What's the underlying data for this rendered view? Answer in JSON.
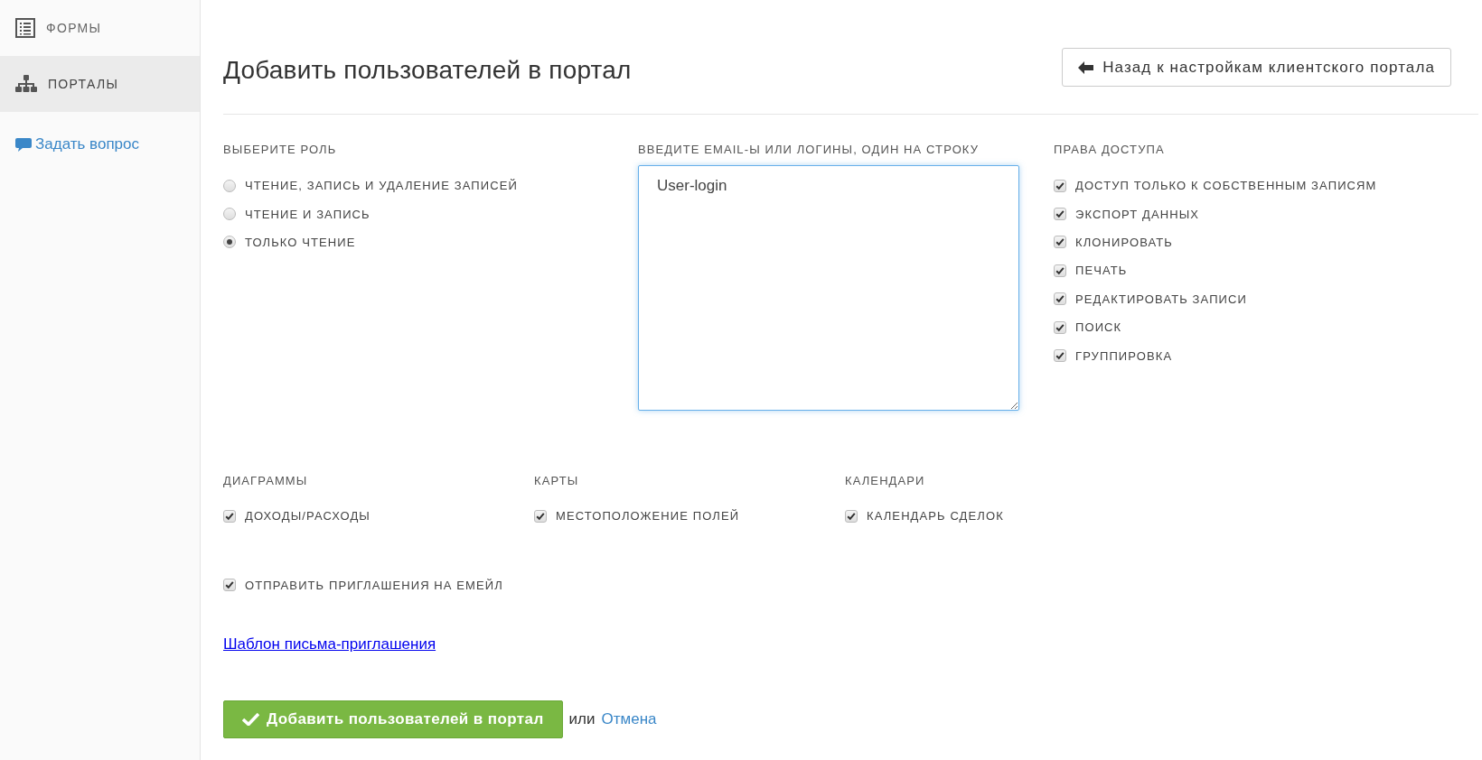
{
  "sidebar": {
    "items": [
      {
        "label": "ФОРМЫ",
        "selected": false
      },
      {
        "label": "ПОРТАЛЫ",
        "selected": true
      }
    ],
    "help_link": "Задать вопрос"
  },
  "header": {
    "title": "Добавить пользователей в портал",
    "back_button": "Назад к настройкам клиентского портала"
  },
  "role": {
    "heading": "ВЫБЕРИТЕ РОЛЬ",
    "options": [
      {
        "label": "ЧТЕНИЕ, ЗАПИСЬ И УДАЛЕНИЕ ЗАПИСЕЙ",
        "selected": false
      },
      {
        "label": "ЧТЕНИЕ И ЗАПИСЬ",
        "selected": false
      },
      {
        "label": "ТОЛЬКО ЧТЕНИЕ",
        "selected": true
      }
    ]
  },
  "users": {
    "heading": "ВВЕДИТЕ EMAIL-Ы ИЛИ ЛОГИНЫ, ОДИН НА СТРОКУ",
    "value": "User-login"
  },
  "access": {
    "heading": "ПРАВА ДОСТУПА",
    "options": [
      {
        "label": "ДОСТУП ТОЛЬКО К СОБСТВЕННЫМ ЗАПИСЯМ",
        "checked": true
      },
      {
        "label": "ЭКСПОРТ ДАННЫХ",
        "checked": true
      },
      {
        "label": "КЛОНИРОВАТЬ",
        "checked": true
      },
      {
        "label": "ПЕЧАТЬ",
        "checked": true
      },
      {
        "label": "РЕДАКТИРОВАТЬ ЗАПИСИ",
        "checked": true
      },
      {
        "label": "ПОИСК",
        "checked": true
      },
      {
        "label": "ГРУППИРОВКА",
        "checked": true
      }
    ]
  },
  "groups": [
    {
      "heading": "ДИАГРАММЫ",
      "options": [
        {
          "label": "ДОХОДЫ/РАСХОДЫ",
          "checked": true
        }
      ]
    },
    {
      "heading": "КАРТЫ",
      "options": [
        {
          "label": "МЕСТОПОЛОЖЕНИЕ ПОЛЕЙ",
          "checked": true
        }
      ]
    },
    {
      "heading": "КАЛЕНДАРИ",
      "options": [
        {
          "label": "КАЛЕНДАРЬ СДЕЛОК",
          "checked": true
        }
      ]
    }
  ],
  "send_invites": {
    "label": "ОТПРАВИТЬ ПРИГЛАШЕНИЯ НА ЕМЕЙЛ",
    "checked": true
  },
  "template_link": "Шаблон письма-приглашения",
  "footer": {
    "submit_button": "Добавить пользователей в портал",
    "separator": "или",
    "cancel_link": "Отмена"
  }
}
